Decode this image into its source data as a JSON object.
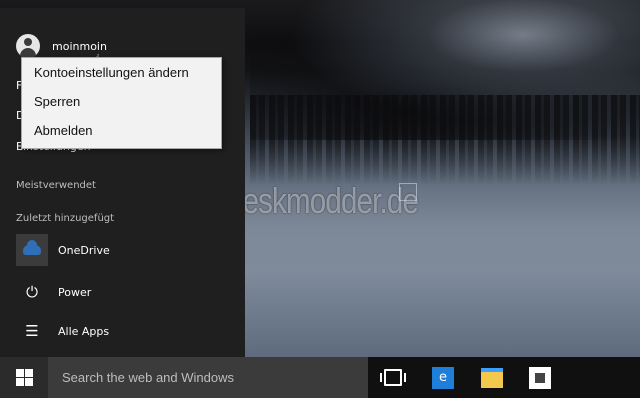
{
  "start_menu": {
    "username": "moinmoin",
    "peek_items": [
      "F",
      "D",
      "Einstellungen"
    ],
    "sections": {
      "most_used": "Meistverwendet",
      "recently_added": "Zuletzt hinzugefügt"
    },
    "app_items": [
      {
        "label": "OneDrive",
        "icon": "onedrive-icon"
      },
      {
        "label": "Power",
        "icon": "power-icon"
      },
      {
        "label": "Alle Apps",
        "icon": "all-apps-icon"
      }
    ]
  },
  "account_context_menu": {
    "items": [
      "Kontoeinstellungen ändern",
      "Sperren",
      "Abmelden"
    ]
  },
  "desktop": {
    "watermark": "Deskmodder.de"
  },
  "taskbar": {
    "search_placeholder": "Search the web and Windows",
    "pinned": [
      "task-view-icon",
      "internet-explorer-icon",
      "file-explorer-icon",
      "store-icon"
    ]
  }
}
